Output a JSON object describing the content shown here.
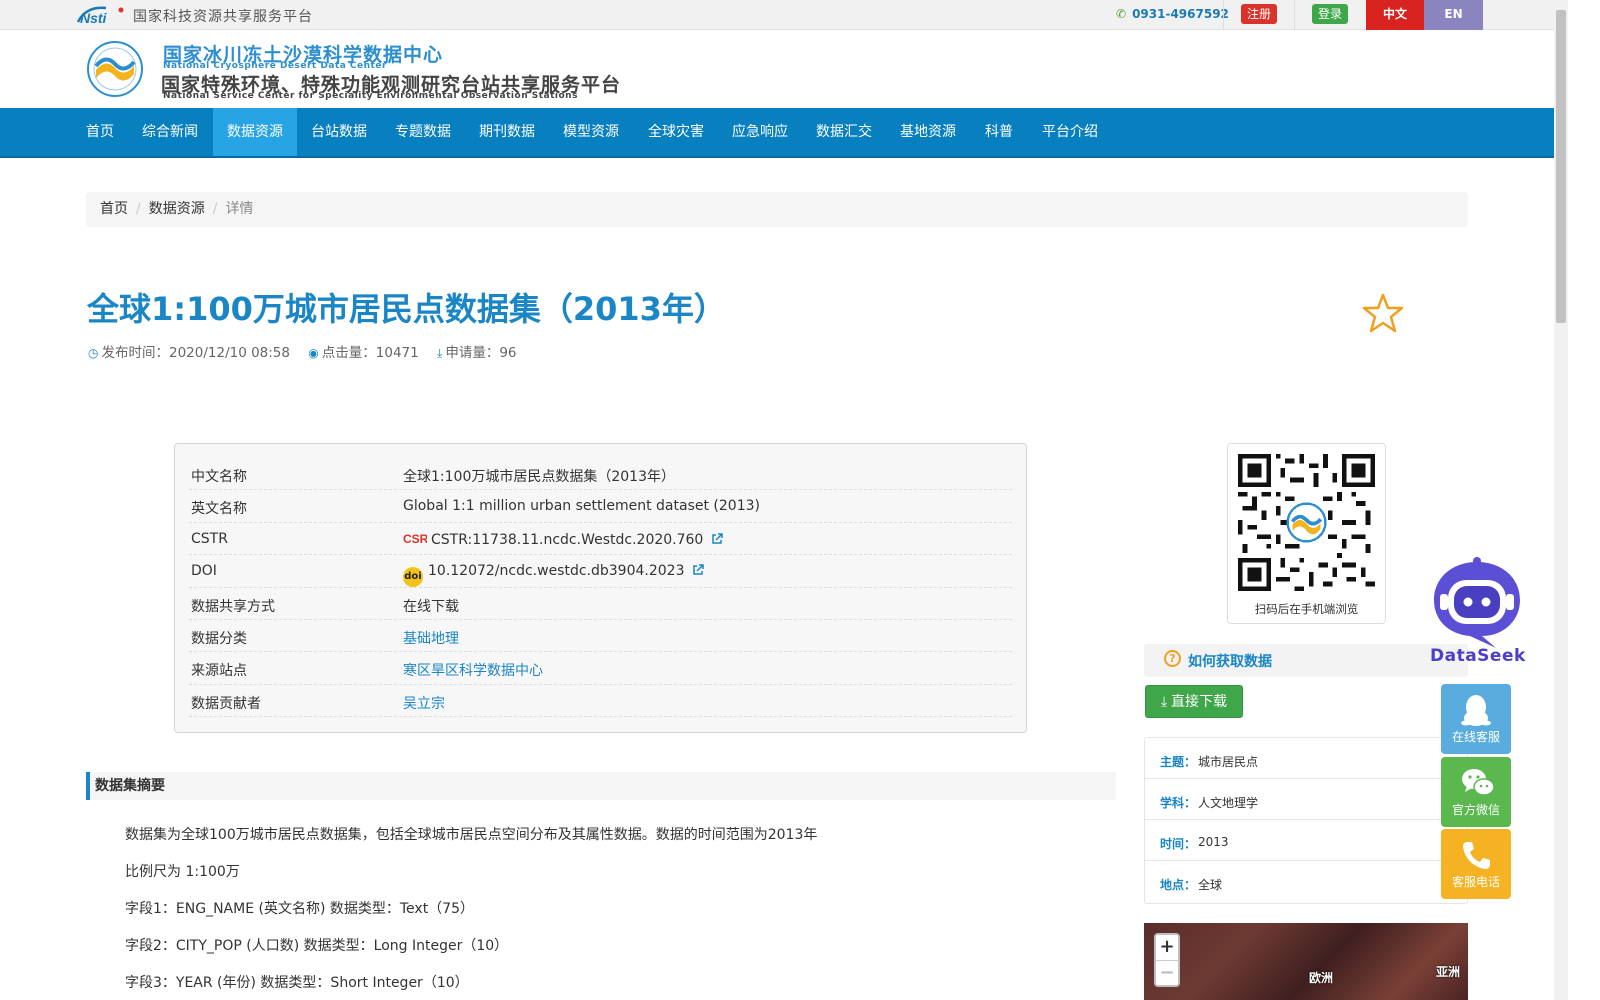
{
  "topbar": {
    "platform_name": "国家科技资源共享服务平台",
    "phone": "0931-4967592",
    "register_label": "注册",
    "login_label": "登录",
    "lang_zh": "中文",
    "lang_en": "EN"
  },
  "header": {
    "title_cn": "国家冰川冻土沙漠科学数据中心",
    "title_en": "National Cryosphere Desert Data Center",
    "subtitle_cn": "国家特殊环境、特殊功能观测研究台站共享服务平台",
    "subtitle_en": "National Service Center for Speciality Environmental Observation Stations"
  },
  "nav": {
    "items": [
      "首页",
      "综合新闻",
      "数据资源",
      "台站数据",
      "专题数据",
      "期刊数据",
      "模型资源",
      "全球灾害",
      "应急响应",
      "数据汇交",
      "基地资源",
      "科普",
      "平台介绍"
    ],
    "active": "数据资源"
  },
  "breadcrumb": [
    "首页",
    "数据资源",
    "详情"
  ],
  "dataset": {
    "title": "全球1:100万城市居民点数据集（2013年）",
    "publish_label": "发布时间：",
    "publish_time": "2020/12/10 08:58",
    "clicks_label": "点击量：",
    "clicks": "10471",
    "applications_label": "申请量：",
    "applications": "96"
  },
  "info": {
    "rows": [
      {
        "key": "中文名称",
        "value": "全球1:100万城市居民点数据集（2013年）"
      },
      {
        "key": "英文名称",
        "value": "Global 1:1 million urban settlement dataset (2013)"
      },
      {
        "key": "CSTR",
        "value": "CSTR:11738.11.ncdc.Westdc.2020.760"
      },
      {
        "key": "DOI",
        "value": "10.12072/ncdc.westdc.db3904.2023"
      },
      {
        "key": "数据共享方式",
        "value": "在线下载"
      },
      {
        "key": "数据分类",
        "value": "基础地理"
      },
      {
        "key": "来源站点",
        "value": "寒区旱区科学数据中心"
      },
      {
        "key": "数据贡献者",
        "value": "吴立宗"
      }
    ],
    "csr_icon_text": "CSR",
    "doi_icon_text": "doi"
  },
  "abstract": {
    "heading": "数据集摘要",
    "paragraphs": [
      "数据集为全球100万城市居民点数据集，包括全球城市居民点空间分布及其属性数据。数据的时间范围为2013年",
      "比例尺为 1:100万",
      "字段1：ENG_NAME (英文名称) 数据类型：Text（75）",
      "字段2：CITY_POP (人口数) 数据类型：Long Integer（10）",
      "字段3：YEAR (年份) 数据类型：Short Integer（10）"
    ]
  },
  "sidebar": {
    "qr_caption": "扫码后在手机端浏览",
    "howto_title": "如何获取数据",
    "download_label": "直接下载",
    "tags": [
      {
        "key": "主题：",
        "value": "城市居民点"
      },
      {
        "key": "学科：",
        "value": "人文地理学"
      },
      {
        "key": "时间：",
        "value": "2013"
      },
      {
        "key": "地点：",
        "value": "全球"
      }
    ],
    "map": {
      "zoom_in": "+",
      "zoom_out": "−",
      "label_europe": "欧洲",
      "label_asia": "亚洲"
    }
  },
  "floating": {
    "dataseek_label": "DataSeek",
    "online_service": "在线客服",
    "wechat": "官方微信",
    "phone_service": "客服电话"
  },
  "colors": {
    "primary_blue": "#0880bf",
    "title_blue": "#1a86c6",
    "green": "#3fa74a",
    "red": "#d8231f",
    "orange": "#f0a020"
  }
}
